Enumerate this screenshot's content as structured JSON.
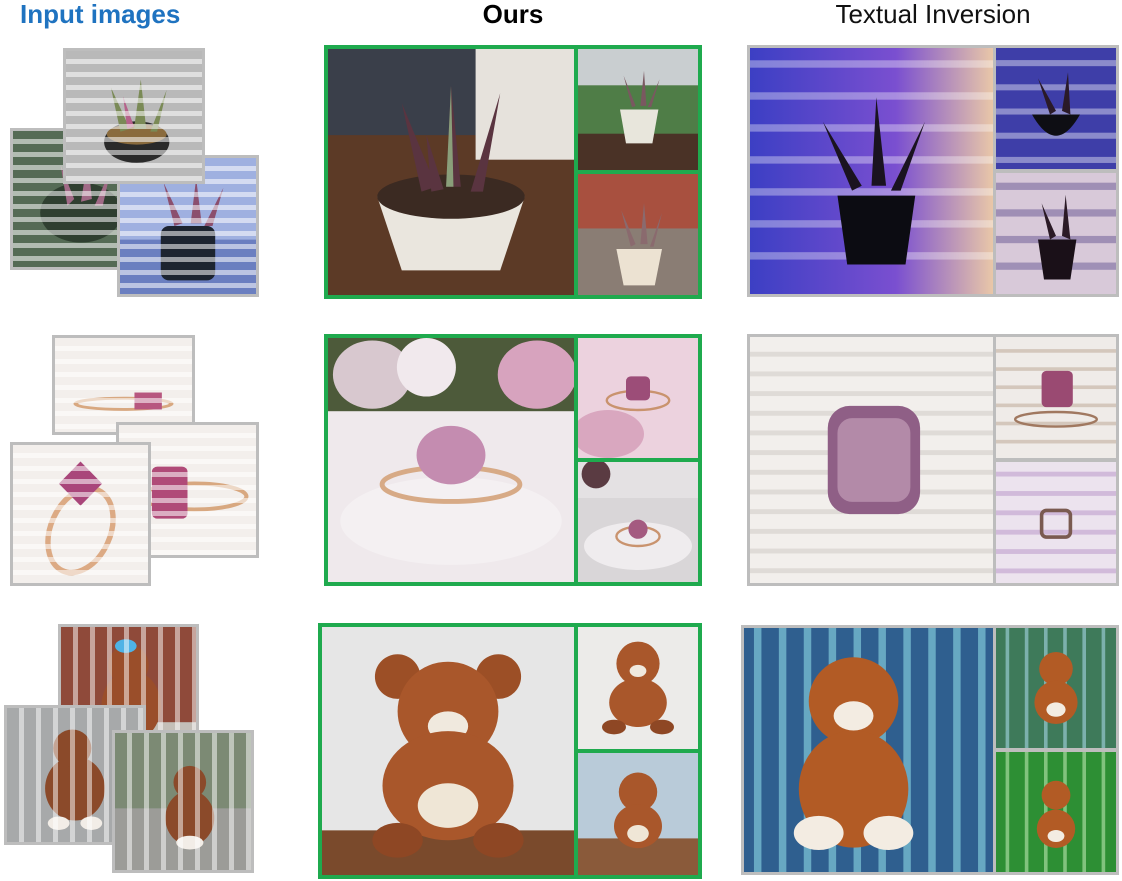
{
  "headers": {
    "input": "Input images",
    "ours": "Ours",
    "textual_inversion": "Textual Inversion"
  },
  "colors": {
    "input_header": "#1f73c0",
    "ours_border": "#1faa4e",
    "ti_border": "#bdbdbd"
  },
  "rows": [
    {
      "subject": "succulent plant in pot"
    },
    {
      "subject": "pink gemstone ring"
    },
    {
      "subject": "brown teddy bear"
    }
  ]
}
